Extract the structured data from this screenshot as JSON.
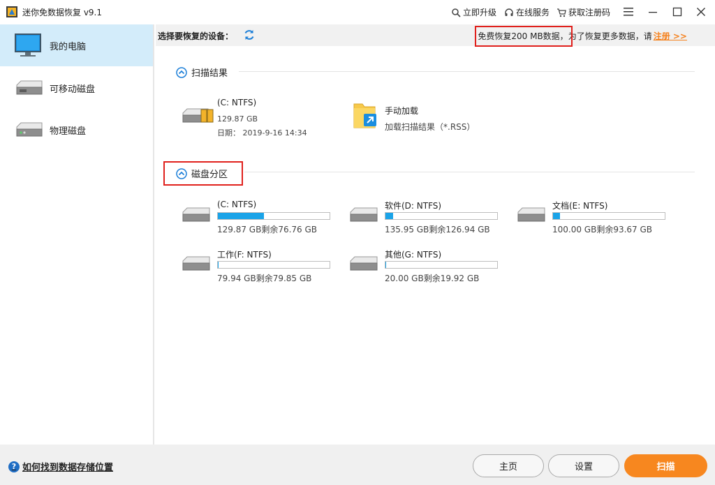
{
  "app": {
    "title": "迷你免数据恢复 v9.1"
  },
  "titlebar": {
    "upgrade": "立即升级",
    "online_service": "在线服务",
    "get_code": "获取注册码"
  },
  "sidebar": {
    "items": [
      {
        "label": "我的电脑",
        "icon": "monitor-icon",
        "active": true
      },
      {
        "label": "可移动磁盘",
        "icon": "removable-disk-icon"
      },
      {
        "label": "物理磁盘",
        "icon": "physical-disk-icon"
      }
    ]
  },
  "device_bar": {
    "label": "选择要恢复的设备：",
    "promo_free": "免费恢复200 MB数据，",
    "promo_more": "为了恢复更多数据，请",
    "register": "注册 >>"
  },
  "scan_results": {
    "heading": "扫描结果",
    "items": [
      {
        "title": "(C: NTFS)",
        "size": "129.87 GB",
        "date": "日期： 2019-9-16 14:34"
      },
      {
        "title": "手动加载",
        "subtitle": "加载扫描结果（*.RSS）"
      }
    ]
  },
  "partitions": {
    "heading": "磁盘分区",
    "items": [
      {
        "name": "(C: NTFS)",
        "capacity": "129.87 GB剩余76.76 GB",
        "used_fraction": 0.41
      },
      {
        "name": "软件(D: NTFS)",
        "capacity": "135.95 GB剩余126.94 GB",
        "used_fraction": 0.066
      },
      {
        "name": "文档(E: NTFS)",
        "capacity": "100.00 GB剩余93.67 GB",
        "used_fraction": 0.063
      },
      {
        "name": "工作(F: NTFS)",
        "capacity": "79.94 GB剩余79.85 GB",
        "used_fraction": 0.001
      },
      {
        "name": "其他(G: NTFS)",
        "capacity": "20.00 GB剩余19.92 GB",
        "used_fraction": 0.004
      }
    ]
  },
  "footer": {
    "help": "如何找到数据存储位置",
    "home": "主页",
    "settings": "设置",
    "scan": "扫描"
  },
  "colors": {
    "accent": "#f7871f",
    "fill": "#1aa3e8",
    "selected": "#d3ecfa",
    "highlight_box": "#e0201c"
  }
}
